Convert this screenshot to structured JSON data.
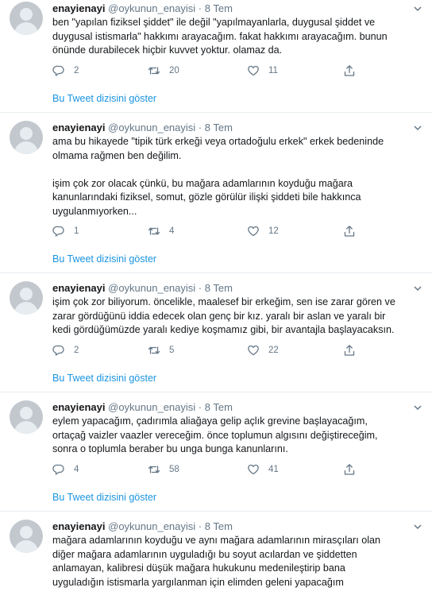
{
  "tweets": [
    {
      "name": "enayienayi",
      "handle": "@oykunun_enayisi",
      "dot": "·",
      "date": "8 Tem",
      "lines": [
        "ben \"yapılan fiziksel şiddet\" ile değil \"yapılmayanlarla, duygusal şiddet ve",
        "duygusal istismarla\" hakkımı arayacağım. fakat hakkımı arayacağım. bunun",
        "önünde durabilecek hiçbir kuvvet yoktur. olamaz da."
      ],
      "replies": "2",
      "retweets": "20",
      "likes": "11",
      "show_thread": "Bu Tweet dizisini göster"
    },
    {
      "name": "enayienayi",
      "handle": "@oykunun_enayisi",
      "dot": "·",
      "date": "8 Tem",
      "lines": [
        "ama bu hikayede \"tipik türk erkeği veya ortadoğulu erkek\" erkek bedeninde",
        "olmama rağmen ben değilim.",
        "",
        "işim çok zor olacak çünkü, bu mağara adamlarının koyduğu mağara",
        "kanunlarındaki fiziksel, somut, gözle görülür ilişki şiddeti bile hakkınca",
        "uygulanmıyorken..."
      ],
      "replies": "1",
      "retweets": "4",
      "likes": "12",
      "show_thread": "Bu Tweet dizisini göster"
    },
    {
      "name": "enayienayi",
      "handle": "@oykunun_enayisi",
      "dot": "·",
      "date": "8 Tem",
      "lines": [
        "işim çok zor biliyorum. öncelikle, maalesef bir erkeğim, sen ise zarar gören ve",
        "zarar gördüğünü iddia edecek olan genç bir kız. yaralı bir aslan ve yaralı bir",
        "kedi gördüğümüzde yaralı kediye koşmamız gibi, bir avantajla başlayacaksın."
      ],
      "replies": "2",
      "retweets": "5",
      "likes": "22",
      "show_thread": "Bu Tweet dizisini göster"
    },
    {
      "name": "enayienayi",
      "handle": "@oykunun_enayisi",
      "dot": "·",
      "date": "8 Tem",
      "lines": [
        "eylem yapacağım, çadırımla aliağaya gelip açlık grevine başlayacağım,",
        "ortaçağ vaizler vaazler vereceğim. önce toplumun algısını değiştireceğim,",
        "sonra o toplumla beraber bu unga bunga kanunlarını."
      ],
      "replies": "4",
      "retweets": "58",
      "likes": "41",
      "show_thread": "Bu Tweet dizisini göster"
    },
    {
      "name": "enayienayi",
      "handle": "@oykunun_enayisi",
      "dot": "·",
      "date": "8 Tem",
      "lines": [
        "mağara adamlarının koyduğu ve aynı mağara adamlarının mirasçıları olan",
        "diğer mağara adamlarının uyguladığı bu soyut acılardan ve şiddetten",
        "anlamayan, kalibresi düşük mağara hukukunu medenileştirip bana",
        "uyguladığın istismarla yargılanman için elimden geleni yapacağım"
      ]
    }
  ],
  "colors": {
    "text": "#14171a",
    "secondary": "#657786",
    "link": "#1b95e0",
    "divider": "#e6ecf0",
    "avatar": "#c2c8cd"
  },
  "icons": {
    "reply": "reply-icon",
    "retweet": "retweet-icon",
    "like": "like-icon",
    "share": "share-icon",
    "caret": "chevron-down-icon",
    "avatar": "default-avatar"
  }
}
